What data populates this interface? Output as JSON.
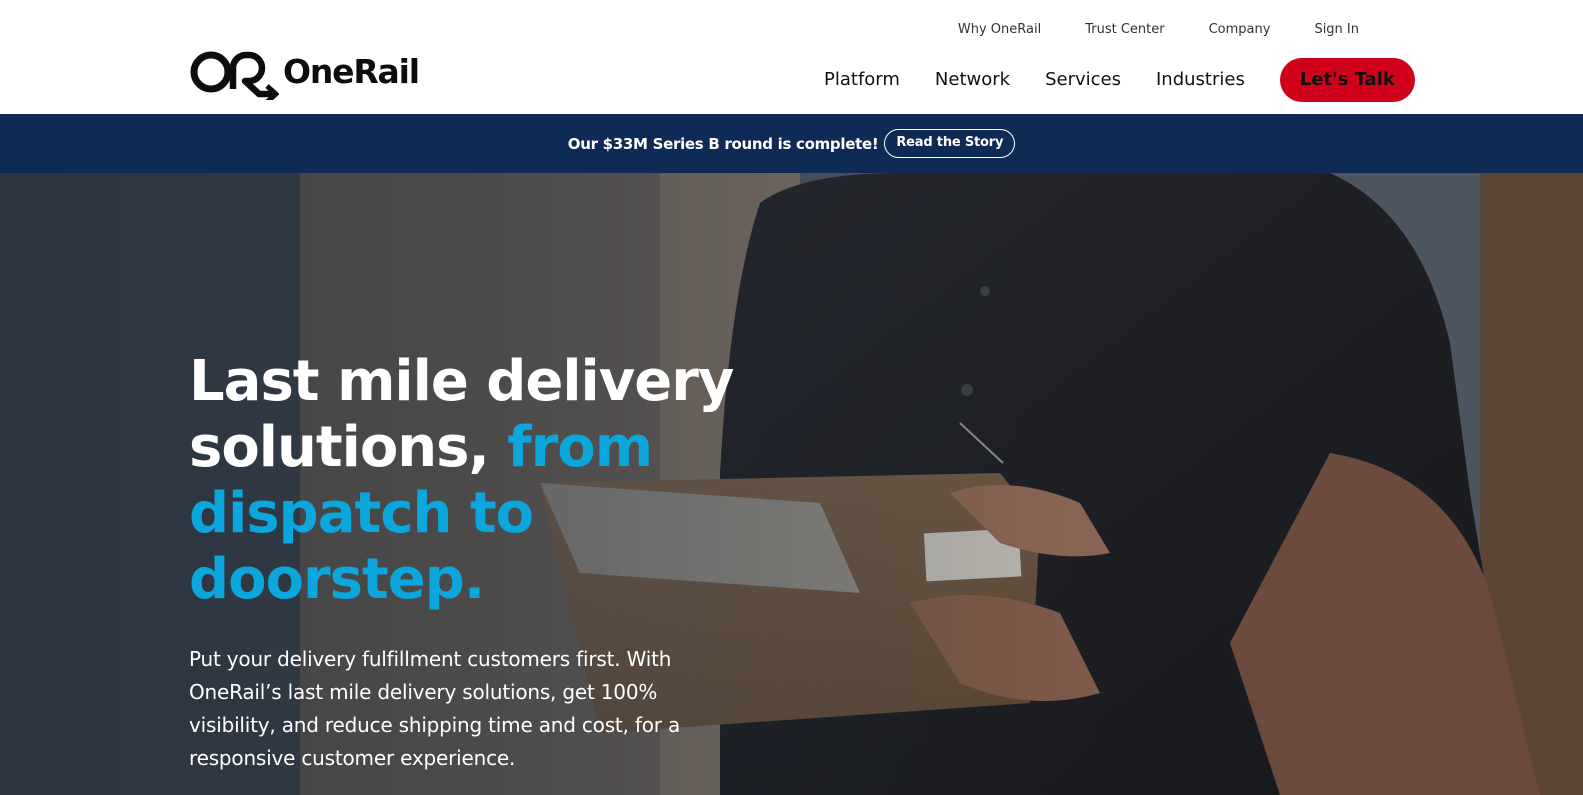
{
  "brand": {
    "name": "OneRail",
    "logo_mark": "onerail-logo-icon",
    "colors": {
      "accent": "#0aa6dc",
      "cta": "#d0021b",
      "banner": "#102a56"
    }
  },
  "utility_nav": {
    "items": [
      {
        "label": "Why OneRail"
      },
      {
        "label": "Trust Center"
      },
      {
        "label": "Company"
      },
      {
        "label": "Sign In"
      }
    ]
  },
  "main_nav": {
    "items": [
      {
        "label": "Platform"
      },
      {
        "label": "Network"
      },
      {
        "label": "Services"
      },
      {
        "label": "Industries"
      }
    ],
    "cta_label": "Let's Talk"
  },
  "announcement": {
    "text": "Our $33M Series B round is complete!",
    "button_label": "Read the Story"
  },
  "hero": {
    "title_white_1": "Last mile delivery",
    "title_white_2": "solutions,",
    "title_accent_1": "from",
    "title_accent_2": "dispatch to",
    "title_accent_3": "doorstep.",
    "subtitle": "Put your delivery fulfillment customers first. With OneRail’s last mile delivery solutions, get 100% visibility, and reduce shipping time and cost, for a responsive customer experience."
  }
}
